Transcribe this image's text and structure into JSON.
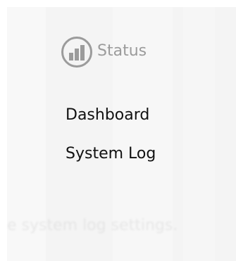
{
  "menu": {
    "header": {
      "icon": "bar-chart-icon",
      "label": "Status"
    },
    "items": [
      {
        "label": "Dashboard"
      },
      {
        "label": "System Log"
      }
    ]
  },
  "background": {
    "faded_text": "e system log settings."
  },
  "colors": {
    "panel_bg": "#f4f4f4",
    "header_gray": "#9b9b9b",
    "item_text": "#111111"
  }
}
